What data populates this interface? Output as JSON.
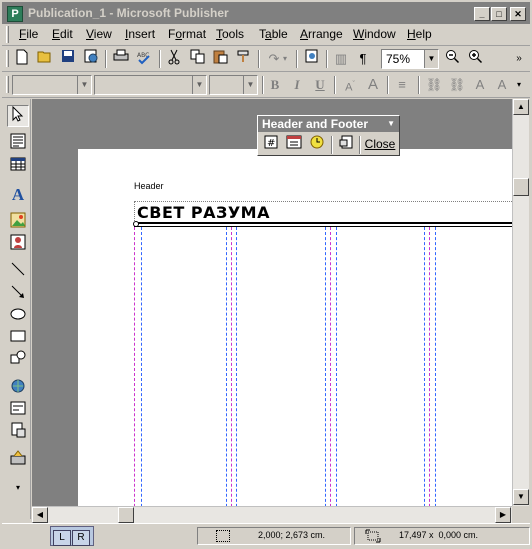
{
  "window": {
    "title": "Publication_1 - Microsoft Publisher",
    "minimize_glyph": "_",
    "maximize_glyph": "□",
    "close_glyph": "✕"
  },
  "menu": {
    "items": [
      {
        "label": "File",
        "accel": "F"
      },
      {
        "label": "Edit",
        "accel": "E"
      },
      {
        "label": "View",
        "accel": "V"
      },
      {
        "label": "Insert",
        "accel": "I"
      },
      {
        "label": "Format",
        "accel": "o"
      },
      {
        "label": "Tools",
        "accel": "T"
      },
      {
        "label": "Table",
        "accel": "a"
      },
      {
        "label": "Arrange",
        "accel": "A"
      },
      {
        "label": "Window",
        "accel": "W"
      },
      {
        "label": "Help",
        "accel": "H"
      }
    ]
  },
  "standard_toolbar": {
    "zoom_value": "75%"
  },
  "formatting_toolbar": {
    "style_value": "",
    "font_value": "",
    "size_value": "",
    "bold": "B",
    "italic": "I",
    "underline": "U"
  },
  "header_footer_toolbar": {
    "title": "Header and Footer",
    "close_label": "Close"
  },
  "page": {
    "header_label": "Header",
    "header_text": "СВЕТ РАЗУМА"
  },
  "tabs": {
    "left": "L",
    "right": "R"
  },
  "status": {
    "position": "2,000; 2,673 cm.",
    "size": "17,497 x  0,000 cm."
  },
  "colors": {
    "title_bar_inactive": "#808080",
    "workspace": "#808080",
    "margin_guide": "#cc33cc",
    "column_guide": "#3366ff"
  }
}
